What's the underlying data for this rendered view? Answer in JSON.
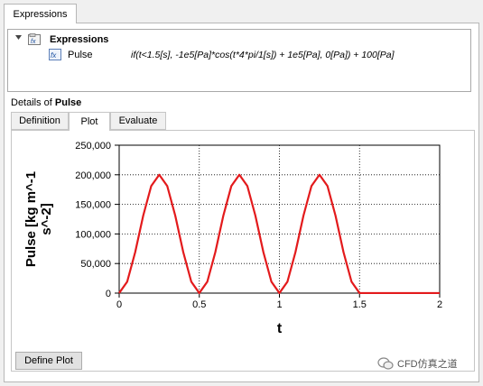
{
  "top_tab": {
    "label": "Expressions"
  },
  "tree": {
    "root_label": "Expressions",
    "item": {
      "name": "Pulse",
      "expression": "if(t<1.5[s], -1e5[Pa]*cos(t*4*pi/1[s]) + 1e5[Pa], 0[Pa]) + 100[Pa]"
    }
  },
  "details": {
    "prefix": "Details of ",
    "name": "Pulse"
  },
  "tabs": [
    {
      "label": "Definition",
      "active": false
    },
    {
      "label": "Plot",
      "active": true
    },
    {
      "label": "Evaluate",
      "active": false
    }
  ],
  "define_plot_button": "Define Plot",
  "watermark": "CFD仿真之道",
  "chart_data": {
    "type": "line",
    "xlabel": "t",
    "ylabel_lines": [
      "Pulse [kg m^-1",
      "s^-2]"
    ],
    "xlim": [
      0,
      2
    ],
    "ylim": [
      0,
      250000
    ],
    "x_ticks": [
      "0",
      "0.5",
      "1",
      "1.5",
      "2"
    ],
    "y_ticks": [
      "0",
      "50,000",
      "100,000",
      "150,000",
      "200,000",
      "250,000"
    ],
    "grid": true,
    "series": [
      {
        "color": "#e31a1c",
        "x": [
          0.0,
          0.05,
          0.1,
          0.15,
          0.2,
          0.25,
          0.3,
          0.35,
          0.4,
          0.45,
          0.5,
          0.55,
          0.6,
          0.65,
          0.7,
          0.75,
          0.8,
          0.85,
          0.9,
          0.95,
          1.0,
          1.05,
          1.1,
          1.15,
          1.2,
          1.25,
          1.3,
          1.35,
          1.4,
          1.45,
          1.5,
          1.6,
          1.8,
          2.0
        ],
        "y": [
          100,
          19200,
          69200,
          130900,
          181000,
          200100,
          181000,
          130900,
          69200,
          19200,
          100,
          19200,
          69200,
          130900,
          181000,
          200100,
          181000,
          130900,
          69200,
          19200,
          100,
          19200,
          69200,
          130900,
          181000,
          200100,
          181000,
          130900,
          69200,
          19200,
          100,
          100,
          100,
          100
        ]
      }
    ]
  }
}
